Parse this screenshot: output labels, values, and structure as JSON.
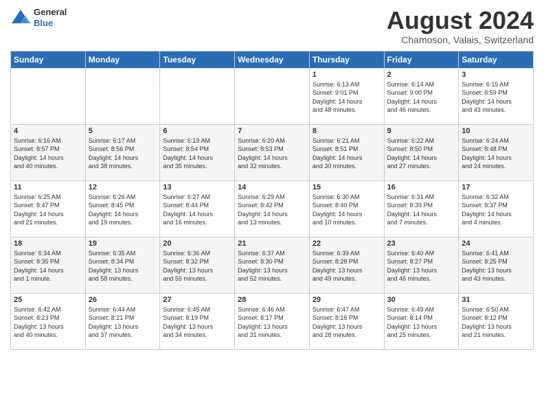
{
  "header": {
    "logo_general": "General",
    "logo_blue": "Blue",
    "month_title": "August 2024",
    "location": "Chamoson, Valais, Switzerland"
  },
  "weekdays": [
    "Sunday",
    "Monday",
    "Tuesday",
    "Wednesday",
    "Thursday",
    "Friday",
    "Saturday"
  ],
  "weeks": [
    [
      {
        "day": "",
        "info": ""
      },
      {
        "day": "",
        "info": ""
      },
      {
        "day": "",
        "info": ""
      },
      {
        "day": "",
        "info": ""
      },
      {
        "day": "1",
        "info": "Sunrise: 6:13 AM\nSunset: 9:01 PM\nDaylight: 14 hours\nand 48 minutes."
      },
      {
        "day": "2",
        "info": "Sunrise: 6:14 AM\nSunset: 9:00 PM\nDaylight: 14 hours\nand 46 minutes."
      },
      {
        "day": "3",
        "info": "Sunrise: 6:15 AM\nSunset: 8:59 PM\nDaylight: 14 hours\nand 43 minutes."
      }
    ],
    [
      {
        "day": "4",
        "info": "Sunrise: 6:16 AM\nSunset: 8:57 PM\nDaylight: 14 hours\nand 40 minutes."
      },
      {
        "day": "5",
        "info": "Sunrise: 6:17 AM\nSunset: 8:56 PM\nDaylight: 14 hours\nand 38 minutes."
      },
      {
        "day": "6",
        "info": "Sunrise: 6:19 AM\nSunset: 8:54 PM\nDaylight: 14 hours\nand 35 minutes."
      },
      {
        "day": "7",
        "info": "Sunrise: 6:20 AM\nSunset: 8:53 PM\nDaylight: 14 hours\nand 32 minutes."
      },
      {
        "day": "8",
        "info": "Sunrise: 6:21 AM\nSunset: 8:51 PM\nDaylight: 14 hours\nand 30 minutes."
      },
      {
        "day": "9",
        "info": "Sunrise: 6:22 AM\nSunset: 8:50 PM\nDaylight: 14 hours\nand 27 minutes."
      },
      {
        "day": "10",
        "info": "Sunrise: 6:24 AM\nSunset: 8:48 PM\nDaylight: 14 hours\nand 24 minutes."
      }
    ],
    [
      {
        "day": "11",
        "info": "Sunrise: 6:25 AM\nSunset: 8:47 PM\nDaylight: 14 hours\nand 21 minutes."
      },
      {
        "day": "12",
        "info": "Sunrise: 6:26 AM\nSunset: 8:45 PM\nDaylight: 14 hours\nand 19 minutes."
      },
      {
        "day": "13",
        "info": "Sunrise: 6:27 AM\nSunset: 8:44 PM\nDaylight: 14 hours\nand 16 minutes."
      },
      {
        "day": "14",
        "info": "Sunrise: 6:29 AM\nSunset: 8:42 PM\nDaylight: 14 hours\nand 13 minutes."
      },
      {
        "day": "15",
        "info": "Sunrise: 6:30 AM\nSunset: 8:40 PM\nDaylight: 14 hours\nand 10 minutes."
      },
      {
        "day": "16",
        "info": "Sunrise: 6:31 AM\nSunset: 8:39 PM\nDaylight: 14 hours\nand 7 minutes."
      },
      {
        "day": "17",
        "info": "Sunrise: 6:32 AM\nSunset: 8:37 PM\nDaylight: 14 hours\nand 4 minutes."
      }
    ],
    [
      {
        "day": "18",
        "info": "Sunrise: 6:34 AM\nSunset: 8:35 PM\nDaylight: 14 hours\nand 1 minute."
      },
      {
        "day": "19",
        "info": "Sunrise: 6:35 AM\nSunset: 8:34 PM\nDaylight: 13 hours\nand 58 minutes."
      },
      {
        "day": "20",
        "info": "Sunrise: 6:36 AM\nSunset: 8:32 PM\nDaylight: 13 hours\nand 55 minutes."
      },
      {
        "day": "21",
        "info": "Sunrise: 6:37 AM\nSunset: 8:30 PM\nDaylight: 13 hours\nand 52 minutes."
      },
      {
        "day": "22",
        "info": "Sunrise: 6:39 AM\nSunset: 8:28 PM\nDaylight: 13 hours\nand 49 minutes."
      },
      {
        "day": "23",
        "info": "Sunrise: 6:40 AM\nSunset: 8:27 PM\nDaylight: 13 hours\nand 46 minutes."
      },
      {
        "day": "24",
        "info": "Sunrise: 6:41 AM\nSunset: 8:25 PM\nDaylight: 13 hours\nand 43 minutes."
      }
    ],
    [
      {
        "day": "25",
        "info": "Sunrise: 6:42 AM\nSunset: 8:23 PM\nDaylight: 13 hours\nand 40 minutes."
      },
      {
        "day": "26",
        "info": "Sunrise: 6:44 AM\nSunset: 8:21 PM\nDaylight: 13 hours\nand 37 minutes."
      },
      {
        "day": "27",
        "info": "Sunrise: 6:45 AM\nSunset: 8:19 PM\nDaylight: 13 hours\nand 34 minutes."
      },
      {
        "day": "28",
        "info": "Sunrise: 6:46 AM\nSunset: 8:17 PM\nDaylight: 13 hours\nand 31 minutes."
      },
      {
        "day": "29",
        "info": "Sunrise: 6:47 AM\nSunset: 8:16 PM\nDaylight: 13 hours\nand 28 minutes."
      },
      {
        "day": "30",
        "info": "Sunrise: 6:49 AM\nSunset: 8:14 PM\nDaylight: 13 hours\nand 25 minutes."
      },
      {
        "day": "31",
        "info": "Sunrise: 6:50 AM\nSunset: 8:12 PM\nDaylight: 13 hours\nand 21 minutes."
      }
    ]
  ]
}
